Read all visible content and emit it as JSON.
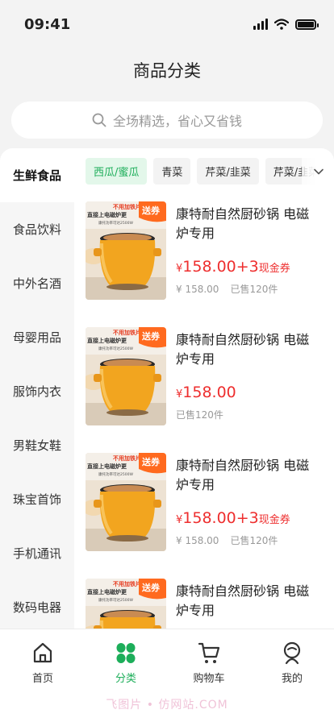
{
  "status": {
    "time": "09:41"
  },
  "page": {
    "title": "商品分类"
  },
  "search": {
    "placeholder": "全场精选，省心又省钱"
  },
  "sidebar": {
    "items": [
      "生鲜食品",
      "食品饮料",
      "中外名酒",
      "母婴用品",
      "服饰内衣",
      "男鞋女鞋",
      "珠宝首饰",
      "手机通讯",
      "数码电器"
    ],
    "active_index": 0
  },
  "chips": {
    "items": [
      "西瓜/蜜瓜",
      "青菜",
      "芹菜/韭菜",
      "芹菜/韭菜"
    ],
    "active_index": 0
  },
  "product_image": {
    "banner_line1": "不用加铁片",
    "banner_line2": "直接上电磁炉更",
    "banner_line3": "康托功率可达2500W",
    "badge": "送券"
  },
  "products": [
    {
      "title": "康特耐自然厨砂锅 电磁炉专用",
      "currency": "¥",
      "price": "158.00",
      "coupon_amount": "+3",
      "coupon_label": "现金券",
      "original_price": "¥ 158.00",
      "sold": "已售120件"
    },
    {
      "title": "康特耐自然厨砂锅 电磁炉专用",
      "currency": "¥",
      "price": "158.00",
      "coupon_amount": "",
      "coupon_label": "",
      "original_price": "",
      "sold": "已售120件"
    },
    {
      "title": "康特耐自然厨砂锅 电磁炉专用",
      "currency": "¥",
      "price": "158.00",
      "coupon_amount": "+3",
      "coupon_label": "现金券",
      "original_price": "¥ 158.00",
      "sold": "已售120件"
    },
    {
      "title": "康特耐自然厨砂锅 电磁炉专用",
      "currency": "",
      "price": "",
      "coupon_amount": "",
      "coupon_label": "",
      "original_price": "",
      "sold": ""
    }
  ],
  "tabbar": {
    "items": [
      {
        "label": "首页",
        "icon": "home-icon"
      },
      {
        "label": "分类",
        "icon": "category-icon"
      },
      {
        "label": "购物车",
        "icon": "cart-icon"
      },
      {
        "label": "我的",
        "icon": "profile-icon"
      }
    ],
    "active_index": 1
  },
  "watermark": "飞图片 • 仿网站.COM",
  "colors": {
    "accent": "#1dae5a",
    "price": "#ee2e2e",
    "chip_active_bg": "#e3f7ea",
    "badge": "#ff6a1f"
  }
}
